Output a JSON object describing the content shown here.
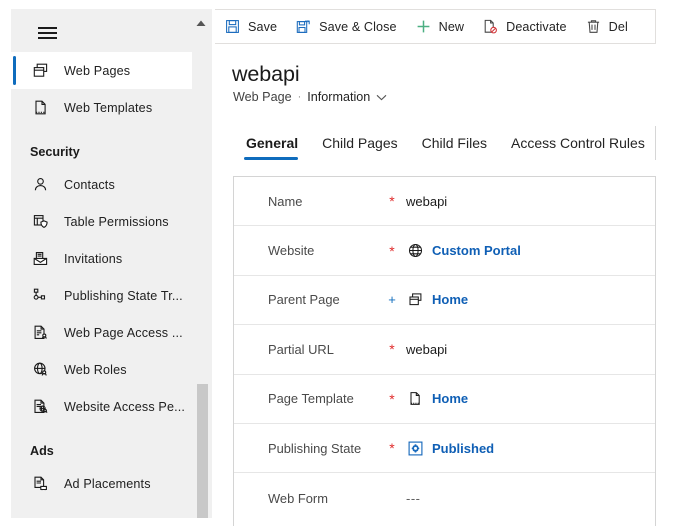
{
  "sidebar": {
    "menu_icon": "hamburger-icon",
    "scroll_up_icon": "scroll-up-arrow-icon",
    "items": [
      {
        "type": "item",
        "label": "Web Pages",
        "icon": "web-pages-icon",
        "selected": true
      },
      {
        "type": "item",
        "label": "Web Templates",
        "icon": "web-templates-icon",
        "selected": false
      },
      {
        "type": "group",
        "label": "Security"
      },
      {
        "type": "item",
        "label": "Contacts",
        "icon": "contacts-icon",
        "selected": false
      },
      {
        "type": "item",
        "label": "Table  Permissions",
        "icon": "table-permissions-icon",
        "selected": false
      },
      {
        "type": "item",
        "label": "Invitations",
        "icon": "invitations-icon",
        "selected": false
      },
      {
        "type": "item",
        "label": "Publishing State Tr...",
        "icon": "publishing-state-icon",
        "selected": false
      },
      {
        "type": "item",
        "label": "Web Page Access ...",
        "icon": "web-page-access-icon",
        "selected": false
      },
      {
        "type": "item",
        "label": "Web Roles",
        "icon": "web-roles-icon",
        "selected": false
      },
      {
        "type": "item",
        "label": "Website Access Pe...",
        "icon": "website-access-icon",
        "selected": false
      },
      {
        "type": "group",
        "label": "Ads"
      },
      {
        "type": "item",
        "label": "Ad Placements",
        "icon": "ad-placements-icon",
        "selected": false
      }
    ]
  },
  "commandbar": {
    "buttons": [
      {
        "label": "Save",
        "icon": "save-icon"
      },
      {
        "label": "Save & Close",
        "icon": "save-and-close-icon"
      },
      {
        "label": "New",
        "icon": "plus-icon"
      },
      {
        "label": "Deactivate",
        "icon": "deactivate-icon"
      },
      {
        "label": "Del",
        "icon": "delete-trash-icon"
      }
    ]
  },
  "header": {
    "title": "webapi",
    "entity": "Web Page",
    "separator": "·",
    "form_name": "Information",
    "form_chevron_icon": "chevron-down-icon"
  },
  "tabs": [
    {
      "label": "General",
      "active": true
    },
    {
      "label": "Child Pages",
      "active": false
    },
    {
      "label": "Child Files",
      "active": false
    },
    {
      "label": "Access Control Rules",
      "active": false
    }
  ],
  "form": {
    "rows": [
      {
        "label": "Name",
        "required": "*",
        "icon": "",
        "value": "webapi",
        "style": "plain"
      },
      {
        "label": "Website",
        "required": "*",
        "icon": "globe-icon",
        "value": "Custom Portal",
        "style": "link"
      },
      {
        "label": "Parent Page",
        "required": "+",
        "icon": "web-pages-icon",
        "value": "Home",
        "style": "link"
      },
      {
        "label": "Partial URL",
        "required": "*",
        "icon": "",
        "value": "webapi",
        "style": "plain"
      },
      {
        "label": "Page Template",
        "required": "*",
        "icon": "page-template-icon",
        "value": "Home",
        "style": "link"
      },
      {
        "label": "Publishing State",
        "required": "*",
        "icon": "published-icon",
        "value": "Published",
        "style": "link"
      },
      {
        "label": "Web Form",
        "required": "",
        "icon": "",
        "value": "---",
        "style": "empty"
      }
    ]
  },
  "colors": {
    "accent": "#0f6cbd",
    "link": "#0f5fb5",
    "required": "#e02b2b",
    "sidebar_bg": "#f0f0f0",
    "scrollbar_thumb": "#c8c8c8"
  }
}
